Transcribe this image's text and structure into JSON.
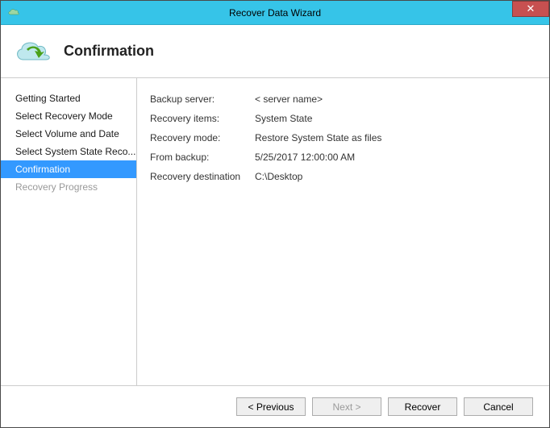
{
  "window": {
    "title": "Recover Data Wizard"
  },
  "header": {
    "title": "Confirmation"
  },
  "sidebar": {
    "items": [
      {
        "label": "Getting Started",
        "state": "normal"
      },
      {
        "label": "Select Recovery Mode",
        "state": "normal"
      },
      {
        "label": "Select Volume and Date",
        "state": "normal"
      },
      {
        "label": "Select System State Reco...",
        "state": "normal"
      },
      {
        "label": "Confirmation",
        "state": "selected"
      },
      {
        "label": "Recovery Progress",
        "state": "disabled"
      }
    ]
  },
  "details": {
    "rows": [
      {
        "label": "Backup server:",
        "value": "< server name>"
      },
      {
        "label": "Recovery items:",
        "value": "System State"
      },
      {
        "label": "Recovery mode:",
        "value": "Restore System State as files"
      },
      {
        "label": "From backup:",
        "value": "5/25/2017 12:00:00 AM"
      },
      {
        "label": "Recovery destination",
        "value": "C:\\Desktop"
      }
    ]
  },
  "footer": {
    "previous": "< Previous",
    "next": "Next >",
    "recover": "Recover",
    "cancel": "Cancel"
  }
}
